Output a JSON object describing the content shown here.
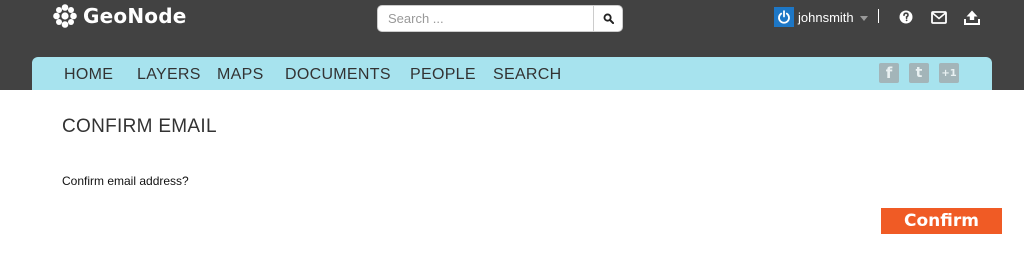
{
  "brand": {
    "name": "GeoNode",
    "icon": "geonode-logo-icon"
  },
  "search": {
    "placeholder": "Search ...",
    "value": "",
    "icon": "search-icon"
  },
  "user": {
    "username": "johnsmith",
    "avatar_icon": "power-icon"
  },
  "header_icons": [
    {
      "name": "help-icon"
    },
    {
      "name": "envelope-icon"
    },
    {
      "name": "upload-icon"
    }
  ],
  "nav": {
    "items": [
      "HOME",
      "LAYERS",
      "MAPS",
      "DOCUMENTS",
      "PEOPLE",
      "SEARCH"
    ]
  },
  "social": {
    "facebook": "f",
    "twitter": "t",
    "plus_one": "+1"
  },
  "page": {
    "title": "CONFIRM EMAIL",
    "message": "Confirm email address?",
    "confirm_label": "Confirm"
  },
  "colors": {
    "topbar": "#424242",
    "navbar": "#a7e3ee",
    "accent": "#f05b25",
    "avatar": "#1d77c6"
  }
}
